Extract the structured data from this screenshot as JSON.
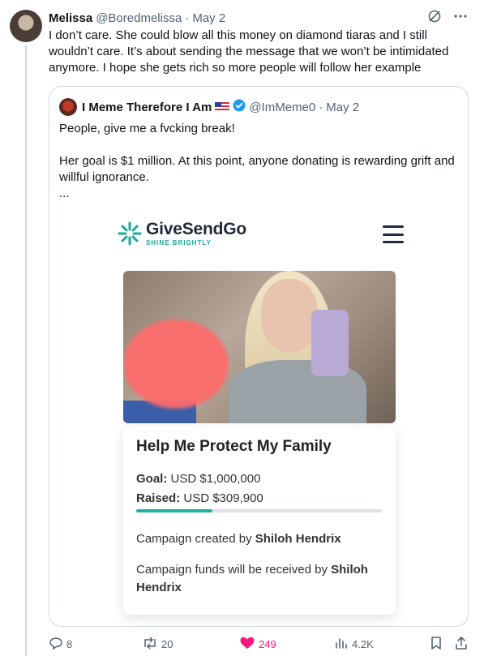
{
  "tweet": {
    "author_name": "Melissa",
    "author_handle": "@Boredmelissa",
    "separator": "·",
    "date": "May 2",
    "text": "I don’t care. She could blow all this money on diamond tiaras and I still wouldn’t care. It’s about sending the message that we won’t be intimidated anymore. I hope she gets rich so more people will follow her example"
  },
  "quote": {
    "author_name": "I Meme Therefore I Am",
    "author_handle": "@ImMeme0",
    "separator": "·",
    "date": "May 2",
    "line1": "People, give me a fvcking break!",
    "line2": "Her goal is $1 million. At this point, anyone donating is rewarding grift and willful ignorance.",
    "line3": "..."
  },
  "media": {
    "brand": "GiveSendGo",
    "tagline": "SHINE BRIGHTLY",
    "card_title": "Help Me Protect My Family",
    "goal_label": "Goal:",
    "goal_value": "USD $1,000,000",
    "raised_label": "Raised:",
    "raised_value": "USD $309,900",
    "progress_fraction": 0.31,
    "created_prefix": "Campaign created by",
    "created_name": "Shiloh Hendrix",
    "funds_prefix": "Campaign funds will be received by",
    "funds_name": "Shiloh Hendrix"
  },
  "actions": {
    "replies": "8",
    "reposts": "20",
    "likes": "249",
    "views": "4.2K"
  },
  "colors": {
    "accent_blue": "#1d9bf0",
    "like_pink": "#f91880",
    "brand_teal": "#18a999",
    "muted": "#536471"
  }
}
